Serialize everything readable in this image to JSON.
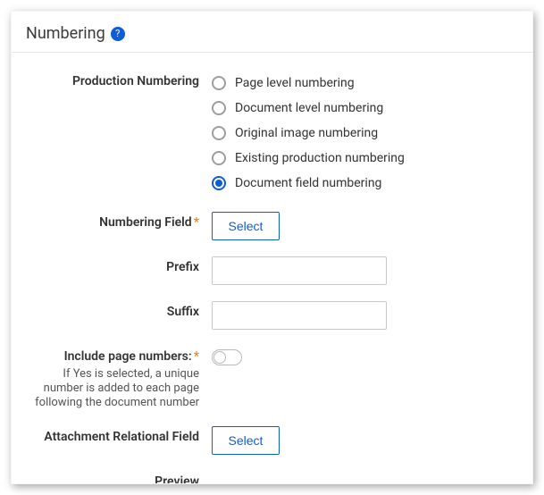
{
  "header": {
    "title": "Numbering"
  },
  "labels": {
    "productionNumbering": "Production Numbering",
    "numberingField": "Numbering Field",
    "prefix": "Prefix",
    "suffix": "Suffix",
    "includePageNumbers": "Include page numbers:",
    "includePageNumbersHint": "If Yes is selected, a unique number is added to each page following the document number",
    "attachmentRelationalField": "Attachment Relational Field",
    "preview": "Preview"
  },
  "radios": {
    "page": "Page level numbering",
    "document": "Document level numbering",
    "original": "Original image numbering",
    "existing": "Existing production numbering",
    "field": "Document field numbering",
    "selected": "field"
  },
  "buttons": {
    "selectNumberingField": "Select",
    "selectAttachmentField": "Select"
  },
  "inputs": {
    "prefix": "",
    "suffix": ""
  },
  "toggles": {
    "includePageNumbers": false
  },
  "glyphs": {
    "help": "?"
  }
}
